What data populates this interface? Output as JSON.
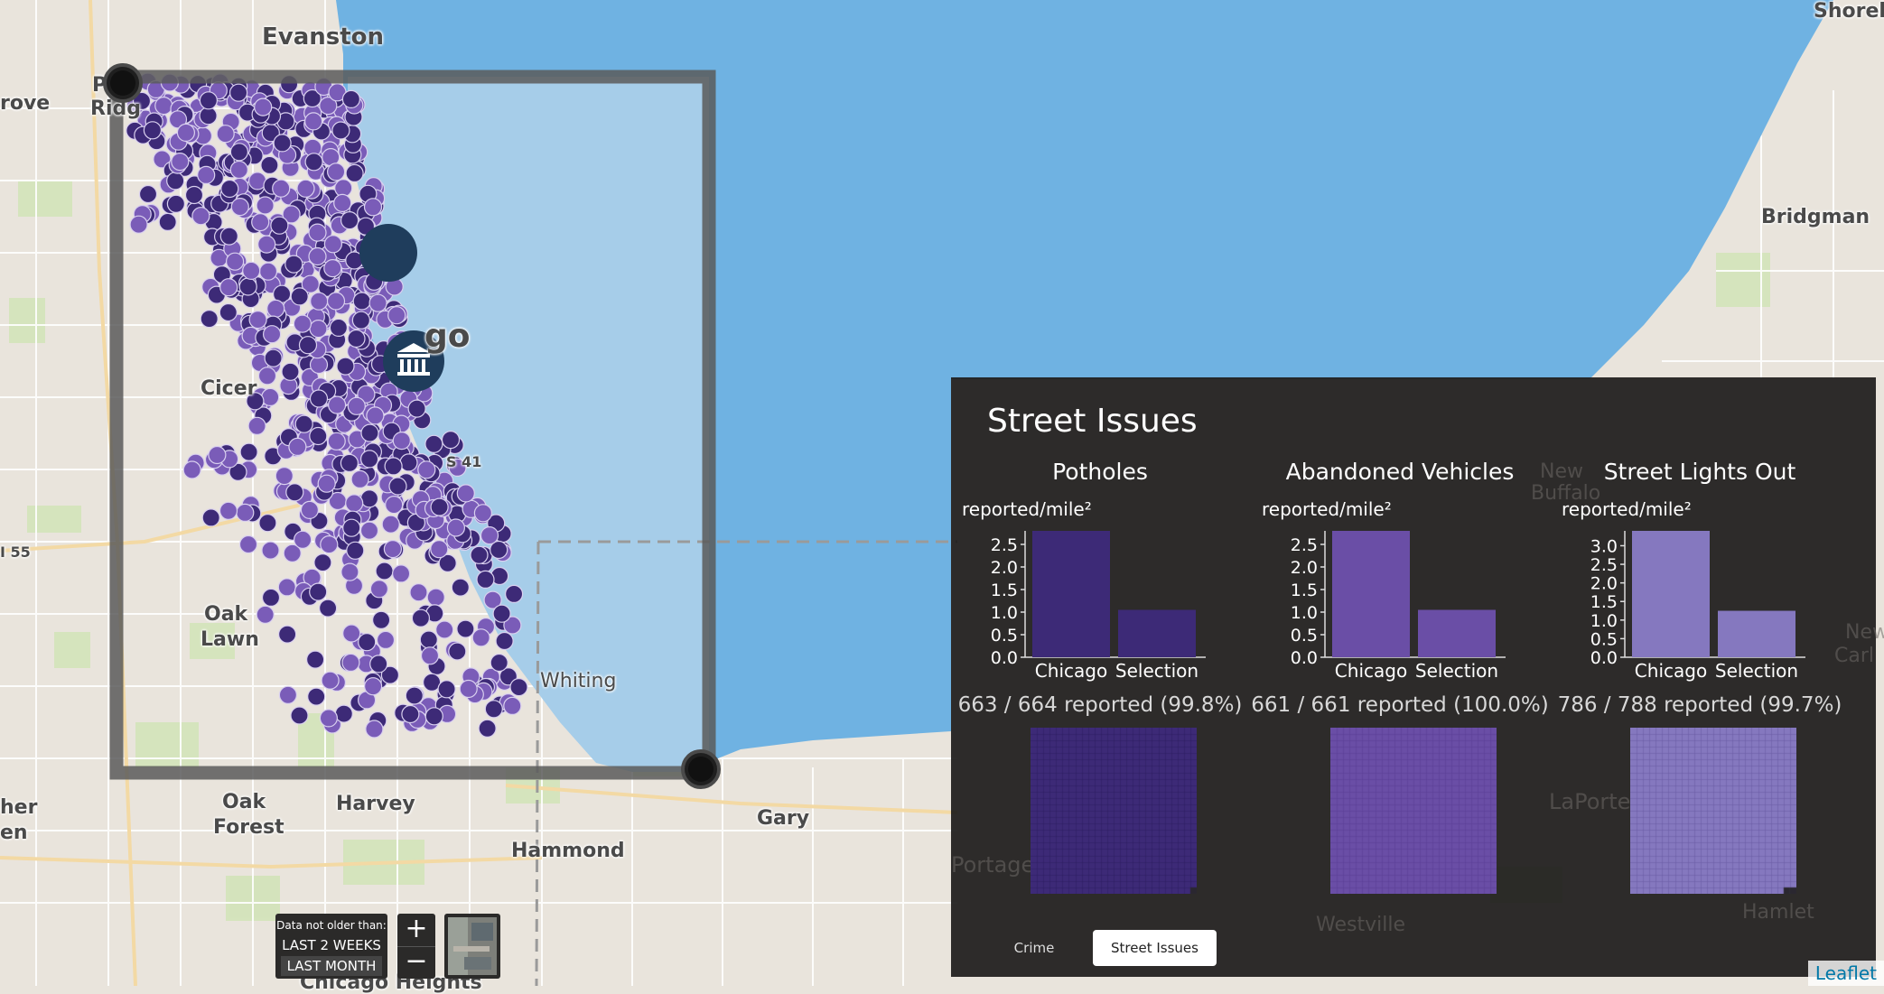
{
  "map": {
    "labels": {
      "evanston": "Evanston",
      "shoreham": "Shoreh",
      "bridgman": "Bridgman",
      "grove": "rove",
      "park_ridge_1": "P",
      "park_ridge_2": "Ridg",
      "chicago_fragment": "go",
      "cicero": "Cicer",
      "route_41": "S 41",
      "route_55": "I 55",
      "oak_lawn_1": "Oak",
      "oak_lawn_2": "Lawn",
      "whiting": "Whiting",
      "oak_forest_1": "Oak",
      "oak_forest_2": "Forest",
      "harvey": "Harvey",
      "gary": "Gary",
      "hammond": "Hammond",
      "chicago_heights": "Chicago Heights",
      "left_her": "her",
      "left_en": "en",
      "new_buffalo_1": "New",
      "new_buffalo_2": "Buffalo",
      "laporte": "LaPorte",
      "portage": "Portage",
      "westville": "Westville",
      "hamlet": "Hamlet",
      "new_carlisle_1": "New",
      "new_carlisle_2": "Carl"
    },
    "colors": {
      "water": "#6fb2e2",
      "selection_fill": "#a6cde9",
      "land": "#e9e4dc",
      "selection_border": "#5b5b5b",
      "dot_dark": "#3d2a77",
      "dot_light": "#7a5cb8"
    },
    "dots": 1050
  },
  "panel": {
    "title": "Street Issues",
    "columns": [
      {
        "title": "Potholes",
        "unit": "reported/mile²",
        "count": "663 / 664 reported (99.8%)",
        "color": "#3d2a77",
        "gridLine": "#2f2063",
        "chart": {
          "categories": [
            "Chicago",
            "Selection"
          ],
          "values": [
            2.8,
            1.05
          ],
          "yticks": [
            "0.0",
            "0.5",
            "1.0",
            "1.5",
            "2.0",
            "2.5"
          ],
          "ymax": 2.8
        },
        "grid_fraction": 0.998
      },
      {
        "title": "Abandoned Vehicles",
        "unit": "reported/mile²",
        "count": "661 / 661 reported (100.0%)",
        "color": "#6a4ea6",
        "gridLine": "#5a3f96",
        "chart": {
          "categories": [
            "Chicago",
            "Selection"
          ],
          "values": [
            2.8,
            1.05
          ],
          "yticks": [
            "0.0",
            "0.5",
            "1.0",
            "1.5",
            "2.0",
            "2.5"
          ],
          "ymax": 2.8
        },
        "grid_fraction": 1.0
      },
      {
        "title": "Street Lights Out",
        "unit": "reported/mile²",
        "count": "786 / 788 reported (99.7%)",
        "color": "#8578bf",
        "gridLine": "#6a5ea6",
        "chart": {
          "categories": [
            "Chicago",
            "Selection"
          ],
          "values": [
            3.4,
            1.25
          ],
          "yticks": [
            "0.0",
            "0.5",
            "1.0",
            "1.5",
            "2.0",
            "2.5",
            "3.0"
          ],
          "ymax": 3.4
        },
        "grid_fraction": 0.997
      }
    ],
    "tabs": {
      "crime": "Crime",
      "street_issues": "Street Issues",
      "active": "street_issues"
    }
  },
  "controls": {
    "time_filter": {
      "label": "Data not older than:",
      "options": [
        "LAST 2 WEEKS",
        "LAST MONTH"
      ],
      "selected": "LAST MONTH"
    },
    "zoom_in": "+",
    "zoom_out": "−",
    "layer_icon": "satellite-layer-thumbnail"
  },
  "attribution": "Leaflet"
}
